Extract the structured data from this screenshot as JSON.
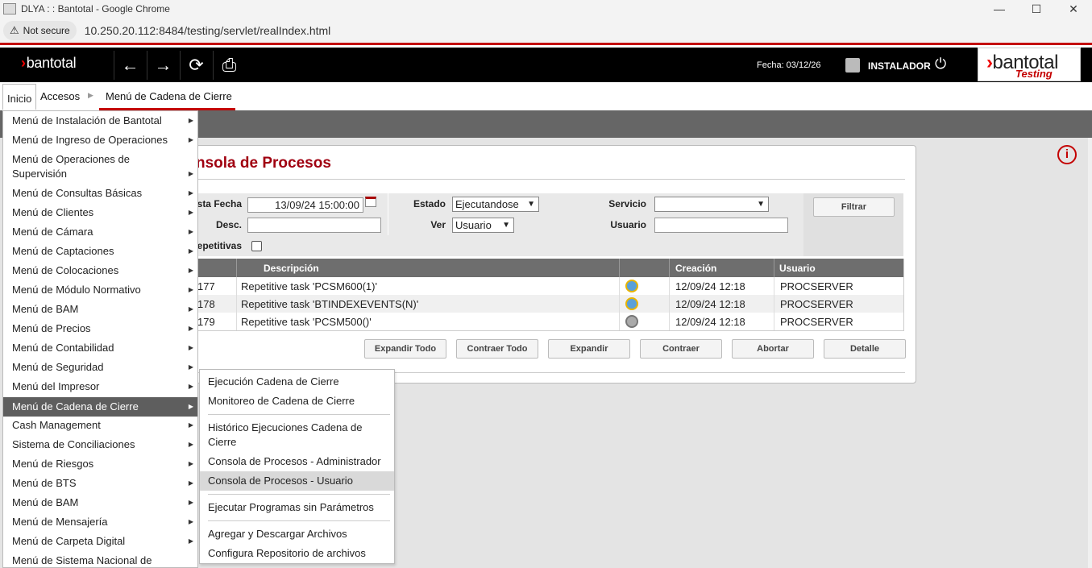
{
  "window": {
    "title": "DLYA : : Bantotal - Google Chrome",
    "minimize": "—",
    "maximize": "☐",
    "close": "✕"
  },
  "address": {
    "security_label": "Not secure",
    "url": "10.250.20.112:8484/testing/servlet/realIndex.html"
  },
  "header": {
    "logo": "bantotal",
    "logo_chevron": "›",
    "fecha": "Fecha: 03/12/26",
    "user": "INSTALADOR",
    "brand": "bantotal",
    "brand_sub": "Testing",
    "icons": [
      "arrow-left-icon",
      "arrow-right-icon",
      "refresh-icon",
      "print-icon",
      "user-icon",
      "power-icon"
    ]
  },
  "breadcrumb": {
    "home": "Inicio",
    "accesos": "Accesos",
    "current": "Menú de Cadena de Cierre"
  },
  "page": {
    "title": "nsola de Procesos",
    "info": "i"
  },
  "filters": {
    "fecha_label": "sta Fecha",
    "fecha_value": "13/09/24 15:00:00",
    "estado_label": "Estado",
    "estado_value": "Ejecutandose",
    "servicio_label": "Servicio",
    "servicio_value": "",
    "desc_label": "Desc.",
    "desc_value": "",
    "ver_label": "Ver",
    "ver_value": "Usuario",
    "usuario_label": "Usuario",
    "usuario_value": "",
    "repetitivas_label": "epetitivas",
    "filtrar": "Filtrar"
  },
  "grid": {
    "headers": [
      "Descripción",
      "Creación",
      "Usuario"
    ],
    "rows": [
      {
        "id": "177",
        "descripcion": "Repetitive task 'PCSM600(1)'",
        "icon": "alarm-clock-icon",
        "creacion": "12/09/24 12:18",
        "usuario": "PROCSERVER"
      },
      {
        "id": "178",
        "descripcion": "Repetitive task 'BTINDEXEVENTS(N)'",
        "icon": "alarm-clock-icon",
        "creacion": "12/09/24 12:18",
        "usuario": "PROCSERVER"
      },
      {
        "id": "179",
        "descripcion": "Repetitive task 'PCSM500()'",
        "icon": "gear-icon",
        "creacion": "12/09/24 12:18",
        "usuario": "PROCSERVER"
      }
    ]
  },
  "actions": {
    "expandir_todo": "Expandir Todo",
    "contraer_todo": "Contraer Todo",
    "expandir": "Expandir",
    "contraer": "Contraer",
    "abortar": "Abortar",
    "detalle": "Detalle"
  },
  "menu": {
    "items": [
      "Menú de Instalación de Bantotal",
      "Menú de Ingreso de Operaciones",
      "Menú de Operaciones de",
      "Supervisión",
      "Menú de Consultas Básicas",
      "Menú de Clientes",
      "Menú de Cámara",
      "Menú de Captaciones",
      "Menú de Colocaciones",
      "Menú de Módulo Normativo",
      "Menú de BAM",
      "Menú de Precios",
      "Menú de Contabilidad",
      "Menú de Seguridad",
      "Menú del Impresor",
      "Menú de Cadena de Cierre",
      "Cash Management",
      "Sistema de Conciliaciones",
      "Menú de Riesgos",
      "Menú de BTS",
      "Menú de BAM",
      "Menú de Mensajería",
      "Menú de Carpeta Digital",
      "Menú de Sistema Nacional de"
    ]
  },
  "submenu": {
    "items": [
      "Ejecución Cadena de Cierre",
      "Monitoreo de Cadena de Cierre",
      "Histórico Ejecuciones Cadena de",
      "Cierre",
      "Consola de Procesos - Administrador",
      "Consola de Procesos - Usuario",
      "Ejecutar Programas sin Parámetros",
      "Agregar y Descargar Archivos",
      "Configura Repositorio de archivos"
    ]
  }
}
